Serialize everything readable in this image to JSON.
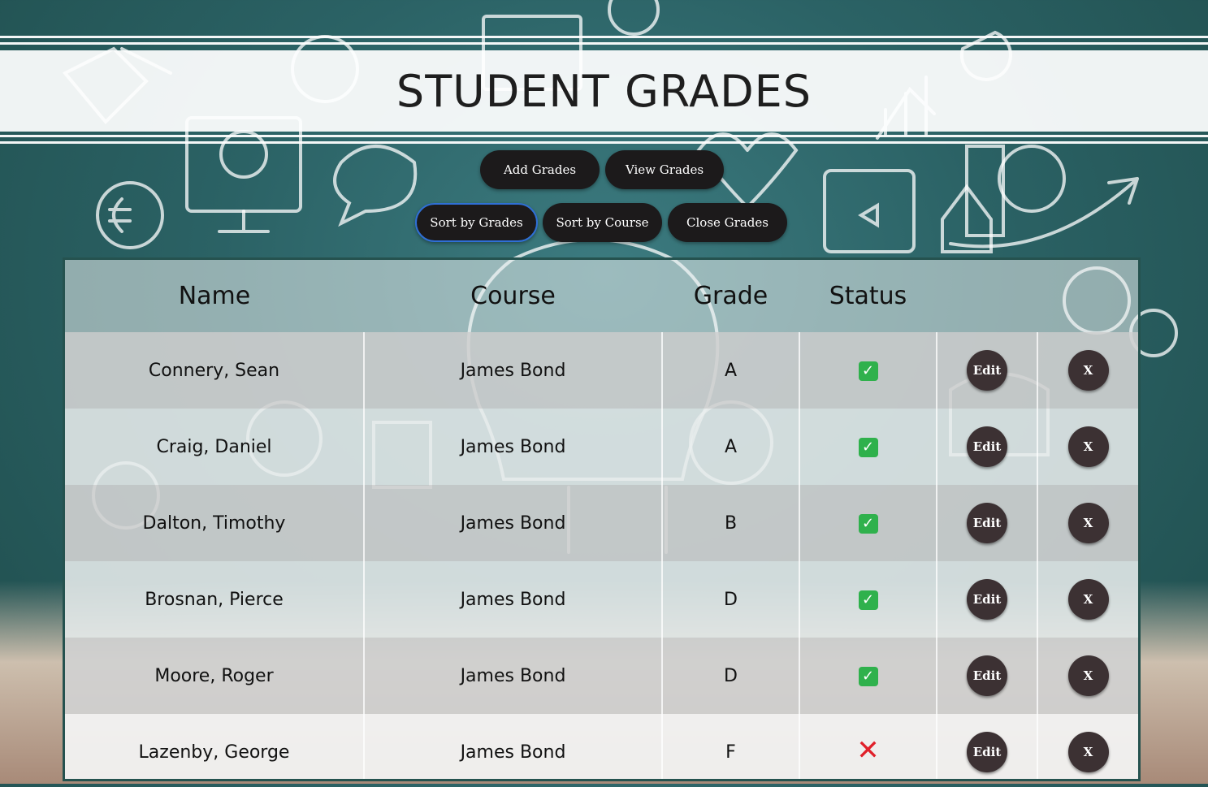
{
  "page": {
    "title": "STUDENT GRADES"
  },
  "toolbar": {
    "add_label": "Add Grades",
    "view_label": "View Grades",
    "sort_grades_label": "Sort by Grades",
    "sort_course_label": "Sort by Course",
    "close_label": "Close Grades"
  },
  "table": {
    "headers": {
      "name": "Name",
      "course": "Course",
      "grade": "Grade",
      "status": "Status"
    },
    "edit_label": "Edit",
    "delete_label": "X",
    "rows": [
      {
        "name": "Connery, Sean",
        "course": "James Bond",
        "grade": "A",
        "status": "pass",
        "status_glyph": "✓"
      },
      {
        "name": "Craig, Daniel",
        "course": "James Bond",
        "grade": "A",
        "status": "pass",
        "status_glyph": "✓"
      },
      {
        "name": "Dalton, Timothy",
        "course": "James Bond",
        "grade": "B",
        "status": "pass",
        "status_glyph": "✓"
      },
      {
        "name": "Brosnan, Pierce",
        "course": "James Bond",
        "grade": "D",
        "status": "pass",
        "status_glyph": "✓"
      },
      {
        "name": "Moore, Roger",
        "course": "James Bond",
        "grade": "D",
        "status": "pass",
        "status_glyph": "✓"
      },
      {
        "name": "Lazenby, George",
        "course": "James Bond",
        "grade": "F",
        "status": "fail",
        "status_glyph": "✕"
      }
    ]
  },
  "colors": {
    "pass": "#2fb14c",
    "fail": "#e0202a",
    "button": "#1c1a1b",
    "round_button": "#3c3133"
  }
}
